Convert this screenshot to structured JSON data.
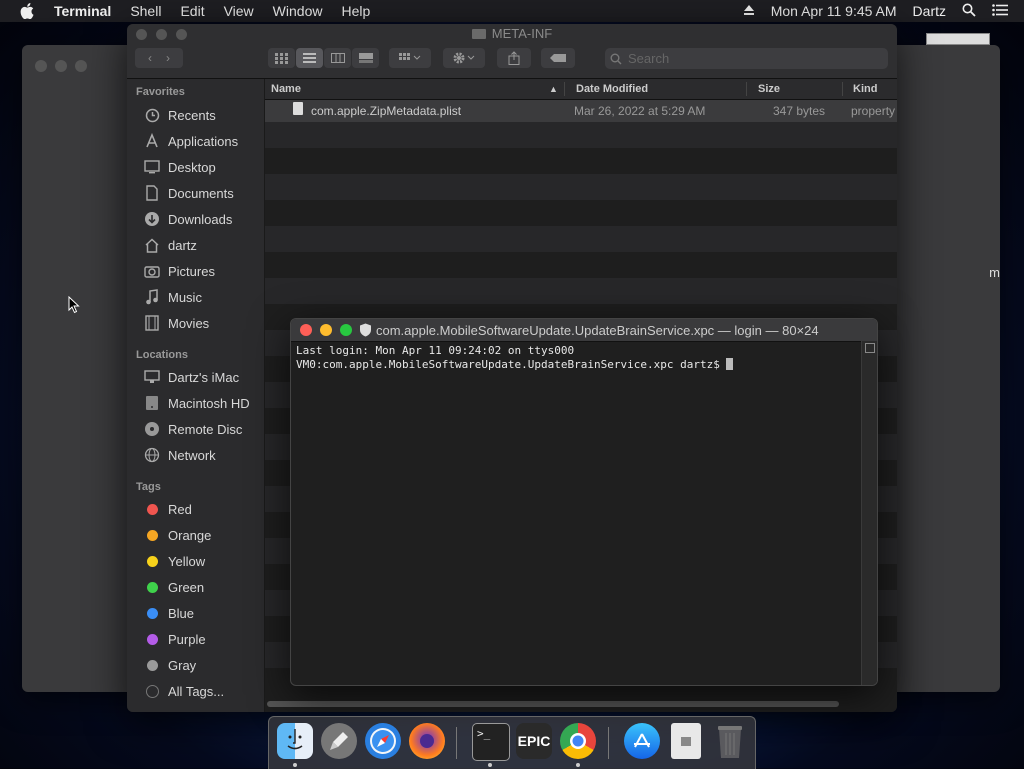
{
  "menubar": {
    "app_name": "Terminal",
    "menus": [
      "Shell",
      "Edit",
      "View",
      "Window",
      "Help"
    ],
    "datetime": "Mon Apr 11  9:45 AM",
    "user": "Dartz"
  },
  "background_window": {
    "fragment_right": "m"
  },
  "finder": {
    "title": "META-INF",
    "search_placeholder": "Search",
    "sidebar": {
      "favorites_header": "Favorites",
      "favorites": [
        "Recents",
        "Applications",
        "Desktop",
        "Documents",
        "Downloads",
        "dartz",
        "Pictures",
        "Music",
        "Movies"
      ],
      "locations_header": "Locations",
      "locations": [
        "Dartz's iMac",
        "Macintosh HD",
        "Remote Disc",
        "Network"
      ],
      "tags_header": "Tags",
      "tags": [
        {
          "label": "Red",
          "color": "#f0554f"
        },
        {
          "label": "Orange",
          "color": "#f5a623"
        },
        {
          "label": "Yellow",
          "color": "#f7d21b"
        },
        {
          "label": "Green",
          "color": "#3fd24b"
        },
        {
          "label": "Blue",
          "color": "#3a8ef6"
        },
        {
          "label": "Purple",
          "color": "#b45ce8"
        },
        {
          "label": "Gray",
          "color": "#9a9a9a"
        },
        {
          "label": "All Tags...",
          "color": "#555555"
        }
      ]
    },
    "columns": {
      "name": "Name",
      "date_modified": "Date Modified",
      "size": "Size",
      "kind": "Kind"
    },
    "files": [
      {
        "name": "com.apple.ZipMetadata.plist",
        "date_modified": "Mar 26, 2022 at 5:29 AM",
        "size": "347 bytes",
        "kind": "property"
      }
    ]
  },
  "terminal": {
    "title": "com.apple.MobileSoftwareUpdate.UpdateBrainService.xpc — login — 80×24",
    "line1": "Last login: Mon Apr 11 09:24:02 on ttys000",
    "line2": "VM0:com.apple.MobileSoftwareUpdate.UpdateBrainService.xpc dartz$ "
  },
  "dock": {
    "apps": [
      "finder-icon",
      "launchpad-icon",
      "safari-icon",
      "firefox-icon",
      "terminal-icon",
      "epic-games-icon",
      "chrome-icon",
      "app-store-icon",
      "file-icon",
      "trash-icon"
    ],
    "epic_label": "EPIC"
  }
}
